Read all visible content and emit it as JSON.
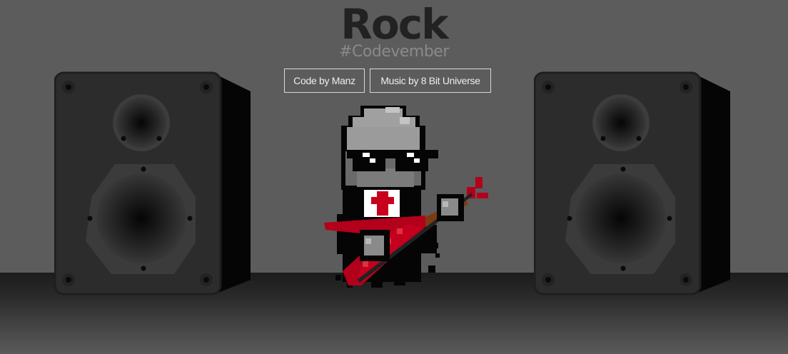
{
  "title": "Rock",
  "subtitle": "#Codevember",
  "credits": [
    {
      "label": "Code by Manz"
    },
    {
      "label": "Music by 8 Bit Universe"
    }
  ],
  "colors": {
    "background": "#5c5c5c",
    "title": "#222222",
    "subtitle": "#8a8a8a",
    "speaker": "#2b2b2b",
    "guitar": "#b3001b"
  }
}
